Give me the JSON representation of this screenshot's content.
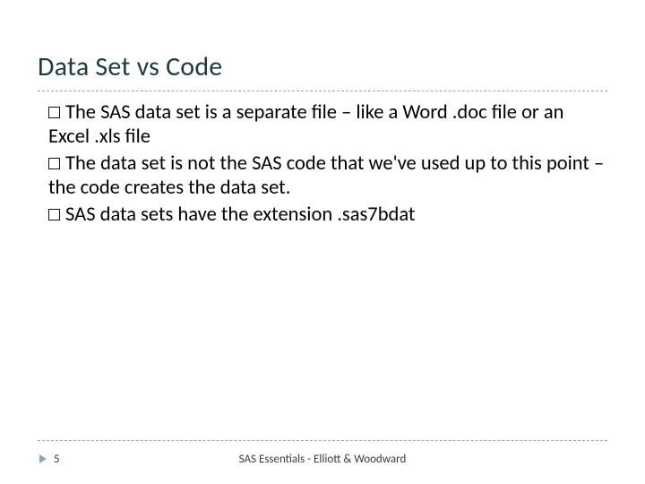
{
  "slide": {
    "title": "Data Set vs Code",
    "bullets": [
      "The SAS data set is a separate file – like a Word .doc file or an Excel .xls file",
      "The data set is not the SAS code that we've used up to this point – the code creates the data set.",
      "SAS data sets have the extension .sas7bdat"
    ],
    "page_number": "5",
    "footer": "SAS Essentials - Elliott & Woodward"
  }
}
